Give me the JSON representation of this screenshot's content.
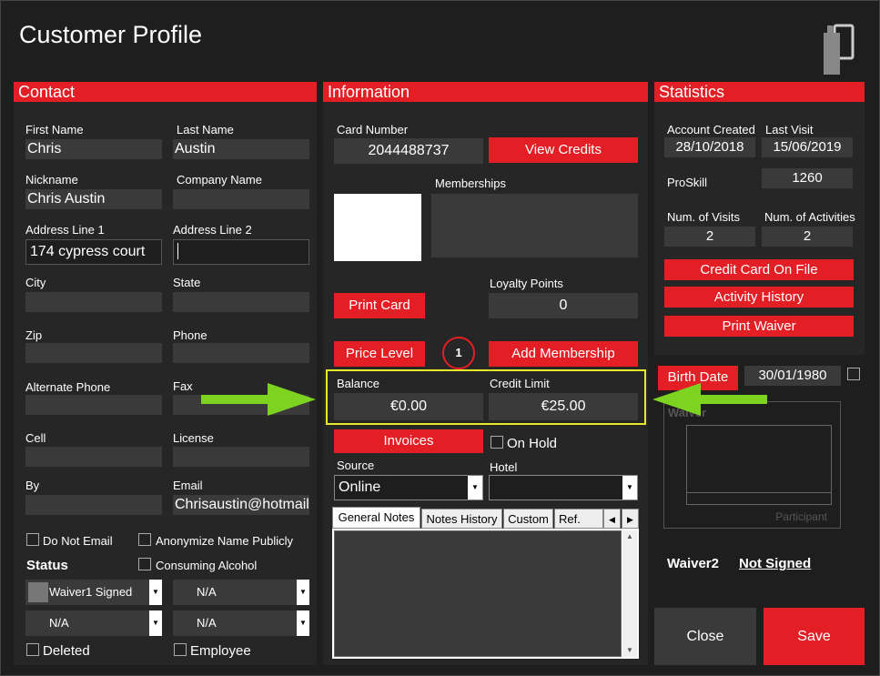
{
  "window": {
    "title": "Customer Profile"
  },
  "contact": {
    "header": "Contact",
    "first_name_label": "First Name",
    "first_name": "Chris",
    "last_name_label": "Last Name",
    "last_name": "Austin",
    "nickname_label": "Nickname",
    "nickname": "Chris Austin",
    "company_label": "Company Name",
    "company": "",
    "address1_label": "Address Line 1",
    "address1": "174 cypress court",
    "address2_label": "Address Line 2",
    "address2": "",
    "city_label": "City",
    "state_label": "State",
    "zip_label": "Zip",
    "phone_label": "Phone",
    "alt_phone_label": "Alternate Phone",
    "fax_label": "Fax",
    "cell_label": "Cell",
    "license_label": "License",
    "by_label": "By",
    "email_label": "Email",
    "email": "Chrisaustin@hotmail.",
    "do_not_email": "Do Not Email",
    "anonymize": "Anonymize Name Publicly",
    "consuming_alcohol": "Consuming Alcohol",
    "status_label": "Status",
    "status1": "Waiver1 Signed",
    "status2": "N/A",
    "status3": "N/A",
    "status4": "N/A",
    "deleted": "Deleted",
    "employee": "Employee"
  },
  "information": {
    "header": "Information",
    "card_number_label": "Card Number",
    "card_number": "2044488737",
    "view_credits": "View Credits",
    "memberships_label": "Memberships",
    "loyalty_label": "Loyalty Points",
    "loyalty": "0",
    "print_card": "Print Card",
    "price_level": "Price Level",
    "badge": "1",
    "add_membership": "Add Membership",
    "balance_label": "Balance",
    "balance": "€0.00",
    "credit_limit_label": "Credit Limit",
    "credit_limit": "€25.00",
    "invoices": "Invoices",
    "on_hold": "On Hold",
    "source_label": "Source",
    "source": "Online",
    "hotel_label": "Hotel",
    "hotel": "",
    "tabs": [
      "General Notes",
      "Notes History",
      "Custom",
      "Ref."
    ]
  },
  "statistics": {
    "header": "Statistics",
    "account_created_label": "Account Created",
    "account_created": "28/10/2018",
    "last_visit_label": "Last Visit",
    "last_visit": "15/06/2019",
    "proskill_label": "ProSkill",
    "proskill": "1260",
    "visits_label": "Num. of Visits",
    "visits": "2",
    "activities_label": "Num. of Activities",
    "activities": "2",
    "credit_card": "Credit Card On File",
    "activity_history": "Activity History",
    "print_waiver": "Print Waiver",
    "birth_date_label": "Birth Date",
    "birth_date": "30/01/1980",
    "waiver_label": "Waiver",
    "participant": "Participant",
    "waiver2_label": "Waiver2",
    "waiver2_status": "Not Signed"
  },
  "footer": {
    "close": "Close",
    "save": "Save"
  },
  "colors": {
    "accent": "#e31e24",
    "highlight": "#e8e82a",
    "arrow": "#7ed321"
  }
}
